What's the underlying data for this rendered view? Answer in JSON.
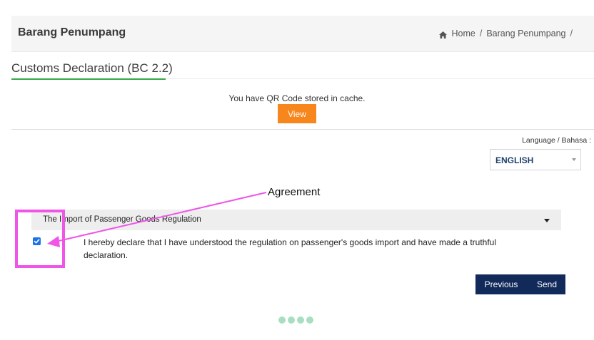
{
  "header": {
    "title": "Barang Penumpang",
    "breadcrumb": [
      "Home",
      "Barang Penumpang"
    ],
    "separator": "/"
  },
  "section": {
    "title": "Customs Declaration (BC 2.2)"
  },
  "qr": {
    "message": "You have QR Code stored in cache.",
    "view_label": "View"
  },
  "language": {
    "label": "Language / Bahasa :",
    "selected": "ENGLISH"
  },
  "annotation": {
    "label": "Agreement",
    "color": "#f055e8"
  },
  "accordion": {
    "title": "The Import of Passenger Goods Regulation"
  },
  "agreement": {
    "checked": true,
    "text": "I hereby declare that I have understood the regulation on passenger's goods import and have made a truthful declaration."
  },
  "nav": {
    "previous_label": "Previous",
    "send_label": "Send"
  },
  "colors": {
    "accent_green": "#37a84a",
    "button_orange": "#f7861d",
    "navy": "#112a5a",
    "checkbox_blue": "#1a73e8"
  }
}
